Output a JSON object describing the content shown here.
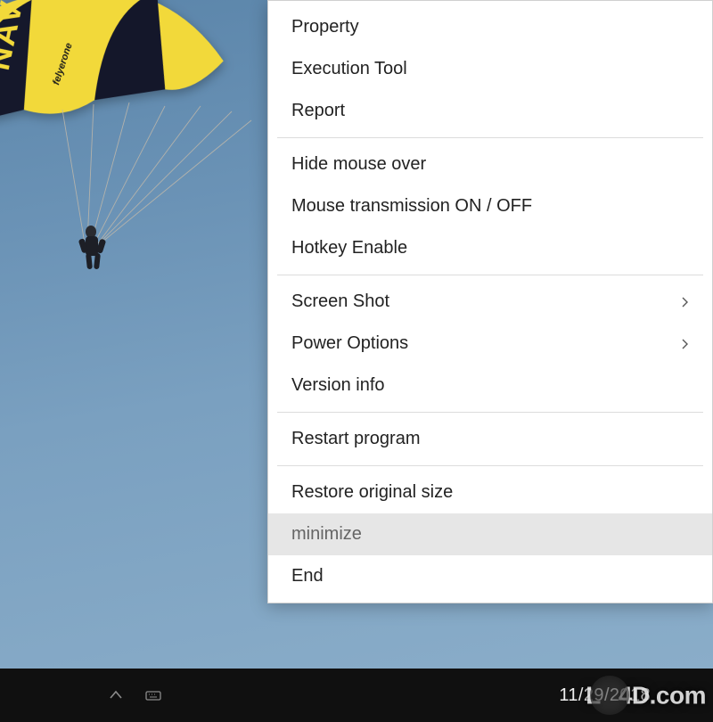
{
  "menu": {
    "groups": [
      [
        {
          "key": "property",
          "label": "Property",
          "submenu": false
        },
        {
          "key": "execution-tool",
          "label": "Execution Tool",
          "submenu": false
        },
        {
          "key": "report",
          "label": "Report",
          "submenu": false
        }
      ],
      [
        {
          "key": "hide-mouse-over",
          "label": "Hide mouse over",
          "submenu": false
        },
        {
          "key": "mouse-transmission",
          "label": "Mouse transmission ON / OFF",
          "submenu": false
        },
        {
          "key": "hotkey-enable",
          "label": "Hotkey Enable",
          "submenu": false
        }
      ],
      [
        {
          "key": "screen-shot",
          "label": "Screen Shot",
          "submenu": true
        },
        {
          "key": "power-options",
          "label": "Power Options",
          "submenu": true
        },
        {
          "key": "version-info",
          "label": "Version info",
          "submenu": false
        }
      ],
      [
        {
          "key": "restart-program",
          "label": "Restart program",
          "submenu": false
        }
      ],
      [
        {
          "key": "restore-original-size",
          "label": "Restore original size",
          "submenu": false
        },
        {
          "key": "minimize",
          "label": "minimize",
          "submenu": false,
          "hovered": true
        },
        {
          "key": "end",
          "label": "End",
          "submenu": false
        }
      ]
    ]
  },
  "taskbar": {
    "date": "11/29/2018"
  },
  "watermark": {
    "text_before": "L",
    "text_after": "4D.com"
  },
  "background": {
    "canopy_text": "NAVY",
    "description": "Sky with Navy parachute"
  }
}
